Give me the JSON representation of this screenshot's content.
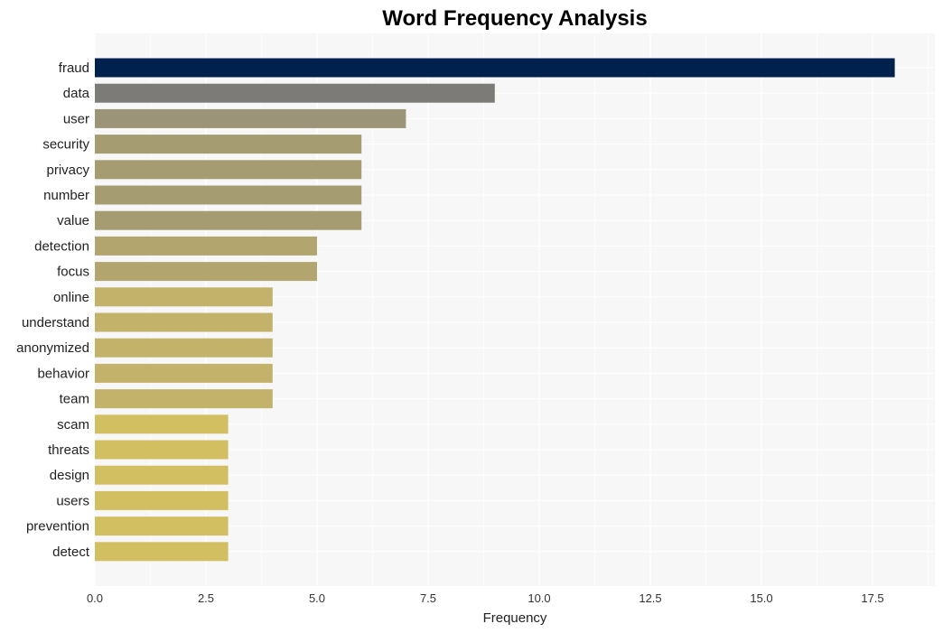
{
  "chart_data": {
    "type": "bar",
    "orientation": "horizontal",
    "title": "Word Frequency Analysis",
    "xlabel": "Frequency",
    "ylabel": "",
    "xlim": [
      0,
      18.9
    ],
    "xticks": [
      0,
      2.5,
      5,
      7.5,
      10,
      12.5,
      15,
      17.5
    ],
    "xtick_labels": [
      "0.0",
      "2.5",
      "5.0",
      "7.5",
      "10.0",
      "12.5",
      "15.0",
      "17.5"
    ],
    "grid": true,
    "categories": [
      "fraud",
      "data",
      "user",
      "security",
      "privacy",
      "number",
      "value",
      "detection",
      "focus",
      "online",
      "understand",
      "anonymized",
      "behavior",
      "team",
      "scam",
      "threats",
      "design",
      "users",
      "prevention",
      "detect"
    ],
    "values": [
      18,
      9,
      7,
      6,
      6,
      6,
      6,
      5,
      5,
      4,
      4,
      4,
      4,
      4,
      3,
      3,
      3,
      3,
      3,
      3
    ],
    "colors": [
      "#00204e",
      "#7c7b78",
      "#9b9478",
      "#a69c72",
      "#a69c72",
      "#a69c72",
      "#a69c72",
      "#b3a56e",
      "#b3a56e",
      "#c2b26a",
      "#c2b26a",
      "#c2b26a",
      "#c2b26a",
      "#c2b26a",
      "#d2bf62",
      "#d2bf62",
      "#d2bf62",
      "#d2bf62",
      "#d2bf62",
      "#d2bf62"
    ],
    "plot_background": "#f7f7f7",
    "grid_color": "#ffffff"
  }
}
